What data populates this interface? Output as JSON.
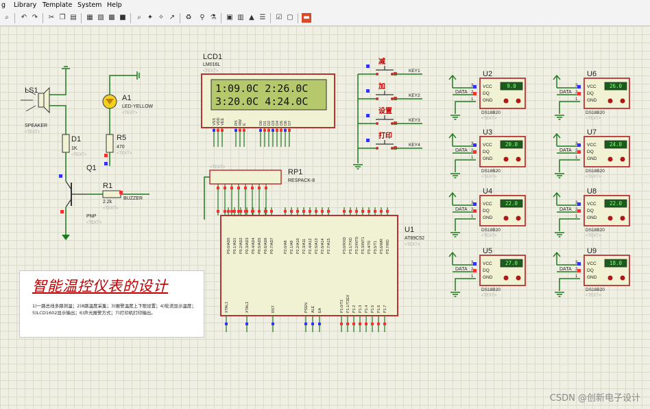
{
  "menu": {
    "items": [
      "g",
      "Library",
      "Template",
      "System",
      "Help"
    ]
  },
  "toolbar": {
    "icons": [
      "zoom-icon",
      "undo-icon",
      "redo-icon",
      "cut-icon",
      "copy-icon",
      "paste-icon",
      "block-copy-icon",
      "block-move-icon",
      "block-rotate-icon",
      "block-delete-icon",
      "pick-device-icon",
      "make-device-icon",
      "packaging-icon",
      "decompose-icon",
      "wire-autoroute-icon",
      "search-icon",
      "property-assign-icon",
      "new-sheet-icon",
      "remove-sheet-icon",
      "zoom-child-icon",
      "bill-of-materials-icon",
      "electrical-rule-check-icon",
      "netlist-icon",
      "pcb-icon"
    ]
  },
  "speaker": {
    "ref": "LS1",
    "type": "SPEAKER",
    "text": "<TEXT>"
  },
  "d1": {
    "ref": "D1",
    "value": "1K",
    "text": "<TEXT>"
  },
  "r5": {
    "ref": "R5",
    "value": "470",
    "text": "<TEXT>"
  },
  "q1": {
    "ref": "Q1",
    "type": "PNP",
    "text": "<TEXT>"
  },
  "r1": {
    "ref": "R1",
    "value": "2.2k",
    "text": "<TEXT>",
    "net": "BUZZER"
  },
  "a1": {
    "ref": "A1",
    "type": "LED-YELLOW",
    "text": "<TEXT>"
  },
  "lcd": {
    "ref": "LCD1",
    "type": "LM016L",
    "text": "<TEXT>",
    "line1": "1:09.0C  2:26.0C",
    "line2": "3:20.0C  4:24.0C",
    "pins": [
      "VSS",
      "VDD",
      "VEE",
      "RS",
      "RW",
      "E",
      "D0",
      "D1",
      "D2",
      "D3",
      "D4",
      "D5",
      "D6",
      "D7"
    ]
  },
  "rp1": {
    "ref": "RP1",
    "type": "RESPACK-8",
    "text": "<TEXT>"
  },
  "u1": {
    "ref": "U1",
    "type": "AT89C52",
    "text": "<TEXT>",
    "p0": [
      "P0.0/AD0",
      "P0.1/AD1",
      "P0.2/AD2",
      "P0.3/AD3",
      "P0.4/AD4",
      "P0.5/AD5",
      "P0.6/AD6",
      "P0.7/AD7"
    ],
    "p2": [
      "P2.0/A8",
      "P2.1/A9",
      "P2.2/A10",
      "P2.3/A11",
      "P2.4/A12",
      "P2.5/A13",
      "P2.6/A14",
      "P2.7/A15"
    ],
    "p3": [
      "P3.0/RXD",
      "P3.1/TXD",
      "P3.2/INT0",
      "P3.3/INT1",
      "P3.4/T0",
      "P3.5/T1",
      "P3.6/WR",
      "P3.7/RD"
    ],
    "bottom": [
      "XTAL1",
      "XTAL2",
      "RST",
      "PSEN",
      "ALE",
      "EA",
      "P1.0/T2",
      "P1.1/T2EX",
      "P1.2",
      "P1.3",
      "P1.4",
      "P1.5",
      "P1.6",
      "P1.7"
    ]
  },
  "keys": [
    {
      "label": "减",
      "net": "KEY1"
    },
    {
      "label": "加",
      "net": "KEY2"
    },
    {
      "label": "设置",
      "net": "KEY3"
    },
    {
      "label": "打印",
      "net": "KEY4"
    }
  ],
  "sensors": [
    {
      "ref": "U2",
      "reading": "9.0"
    },
    {
      "ref": "U3",
      "reading": "20.0"
    },
    {
      "ref": "U4",
      "reading": "22.0"
    },
    {
      "ref": "U5",
      "reading": "27.0"
    },
    {
      "ref": "U6",
      "reading": "26.0"
    },
    {
      "ref": "U7",
      "reading": "24.0"
    },
    {
      "ref": "U8",
      "reading": "22.0"
    },
    {
      "ref": "U9",
      "reading": "18.0"
    }
  ],
  "sensor_common": {
    "type": "DS18B20",
    "text": "<TEXT>",
    "net": "DATA",
    "pins": [
      "VCC",
      "DQ",
      "GND"
    ]
  },
  "note": {
    "title": "智能温控仪表的设计",
    "body": "1)一路总线多路测温；2)8路温度采集；3)报警温度上下限设置；4)轮流显示温度；5)LCD1602显示输出；6)声光报警方式；7)打印机打印输出。"
  },
  "watermark": "CSDN @创新电子设计",
  "colors": {
    "wire": "#1f7a1f",
    "body": "#b83232",
    "lcd_bg": "#b5c86c",
    "display_bg": "#1a5c1a",
    "display_text": "#8cff8c",
    "part_fill": "#f1f1d3"
  }
}
